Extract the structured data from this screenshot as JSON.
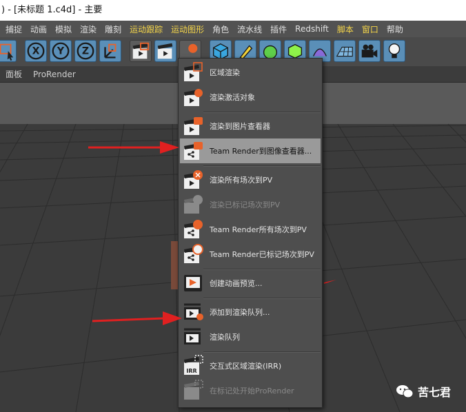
{
  "window": {
    "title": ") - [未标题 1.c4d] - 主要"
  },
  "menubar": {
    "items": [
      {
        "label": "捕捉",
        "highlight": false
      },
      {
        "label": "动画",
        "highlight": false
      },
      {
        "label": "模拟",
        "highlight": false
      },
      {
        "label": "渲染",
        "highlight": false
      },
      {
        "label": "雕刻",
        "highlight": false
      },
      {
        "label": "运动跟踪",
        "highlight": true
      },
      {
        "label": "运动图形",
        "highlight": true
      },
      {
        "label": "角色",
        "highlight": false
      },
      {
        "label": "流水线",
        "highlight": false
      },
      {
        "label": "插件",
        "highlight": false
      },
      {
        "label": "Redshift",
        "highlight": false
      },
      {
        "label": "脚本",
        "highlight": true
      },
      {
        "label": "窗口",
        "highlight": true
      },
      {
        "label": "帮助",
        "highlight": false
      }
    ]
  },
  "toolbar": {
    "axis_x": "X",
    "axis_y": "Y",
    "axis_z": "Z"
  },
  "subbar": {
    "items": [
      "面板",
      "ProRender"
    ]
  },
  "render_menu": {
    "items": [
      {
        "label": "区域渲染",
        "state": "normal"
      },
      {
        "label": "渲染激活对象",
        "state": "normal"
      },
      {
        "label": "渲染到图片查看器",
        "state": "normal"
      },
      {
        "label": "Team Render到图像查看器...",
        "state": "hover"
      },
      {
        "label": "渲染所有场次到PV",
        "state": "normal"
      },
      {
        "label": "渲染已标记场次到PV",
        "state": "disabled"
      },
      {
        "label": "Team Render所有场次到PV",
        "state": "normal"
      },
      {
        "label": "Team Render已标记场次到PV",
        "state": "normal"
      },
      {
        "label": "创建动画预览...",
        "state": "normal"
      },
      {
        "label": "添加到渲染队列...",
        "state": "normal"
      },
      {
        "label": "渲染队列",
        "state": "normal"
      },
      {
        "label": "交互式区域渲染(IRR)",
        "state": "normal"
      },
      {
        "label": "在标记处开始ProRender",
        "state": "disabled"
      }
    ]
  },
  "icons": {
    "irr_text": "IRR"
  },
  "watermark": {
    "text": "苦七君"
  },
  "colors": {
    "highlight_menu_text": "#f5d64a",
    "annotation_arrow": "#e02020",
    "accent_orange": "#e8622a"
  }
}
